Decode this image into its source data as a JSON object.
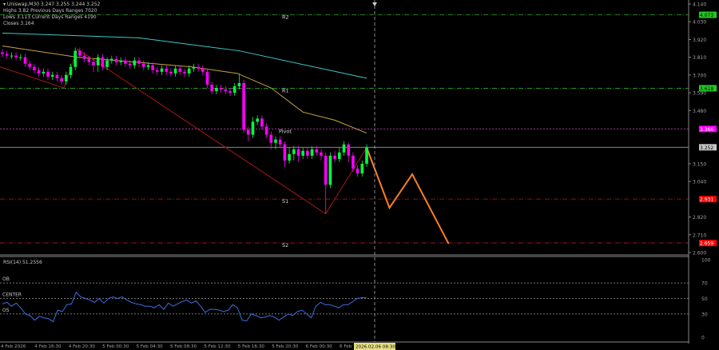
{
  "header": {
    "symbol_line": "Uniswap,M30  3.247 3.255 3.244 3.252",
    "high_line": "Highs 3.82    Previous Days Ranges 7020",
    "low_line": "Lows 3.113    Current Days Ranges 4190",
    "close_line": "Closes 3.164"
  },
  "chart_data": [
    {
      "type": "candlestick",
      "symbol": "Uniswap",
      "timeframe": "M30",
      "ylim": [
        2.6,
        4.14
      ],
      "y_ticks": [
        "4.140",
        "4.030",
        "3.920",
        "3.810",
        "3.700",
        "3.590",
        "3.480",
        "3.150",
        "3.040",
        "2.820",
        "2.710",
        "2.600"
      ],
      "x_ticks": [
        "4 Feb 2026",
        "4 Feb 16:30",
        "4 Feb 20:30",
        "5 Feb 00:30",
        "5 Feb 04:30",
        "5 Feb 08:30",
        "5 Feb 12:30",
        "5 Feb 16:30",
        "5 Feb 20:30",
        "6 Feb 00:30",
        "6 Feb"
      ],
      "crosshair_time": "2026.02.06 08:30",
      "current_price": {
        "label": "3.252",
        "value": 3.252,
        "color": "#9a9a9a"
      },
      "colors": {
        "bull": "#00ff40",
        "bear": "#ff00ff"
      },
      "open": [
        3.84,
        3.83,
        3.82,
        3.82,
        3.81,
        3.81,
        3.77,
        3.75,
        3.73,
        3.71,
        3.72,
        3.69,
        3.7,
        3.68,
        3.66,
        3.7,
        3.75,
        3.85,
        3.82,
        3.8,
        3.78,
        3.76,
        3.81,
        3.75,
        3.79,
        3.8,
        3.78,
        3.79,
        3.77,
        3.76,
        3.79,
        3.77,
        3.75,
        3.76,
        3.73,
        3.72,
        3.74,
        3.72,
        3.71,
        3.74,
        3.72,
        3.71,
        3.74,
        3.75,
        3.74,
        3.72,
        3.64,
        3.6,
        3.62,
        3.61,
        3.6,
        3.59,
        3.63,
        3.65,
        3.36,
        3.33,
        3.41,
        3.43,
        3.38,
        3.33,
        3.28,
        3.3,
        3.27,
        3.17,
        3.21,
        3.24,
        3.2,
        3.23,
        3.2,
        3.24,
        3.22,
        3.2,
        3.02,
        3.2,
        3.18,
        3.22,
        3.27,
        3.2,
        3.12,
        3.09,
        3.15
      ],
      "high": [
        3.86,
        3.85,
        3.84,
        3.84,
        3.83,
        3.83,
        3.79,
        3.77,
        3.75,
        3.74,
        3.74,
        3.72,
        3.72,
        3.7,
        3.72,
        3.77,
        3.87,
        3.87,
        3.84,
        3.82,
        3.8,
        3.83,
        3.83,
        3.81,
        3.82,
        3.82,
        3.81,
        3.81,
        3.79,
        3.81,
        3.81,
        3.79,
        3.78,
        3.78,
        3.75,
        3.76,
        3.76,
        3.74,
        3.76,
        3.76,
        3.74,
        3.76,
        3.77,
        3.77,
        3.76,
        3.74,
        3.66,
        3.64,
        3.64,
        3.63,
        3.62,
        3.65,
        3.71,
        3.67,
        3.38,
        3.44,
        3.45,
        3.45,
        3.4,
        3.35,
        3.32,
        3.32,
        3.29,
        3.25,
        3.26,
        3.26,
        3.25,
        3.25,
        3.26,
        3.26,
        3.24,
        3.22,
        3.22,
        3.23,
        3.25,
        3.29,
        3.28,
        3.22,
        3.14,
        3.17,
        3.27
      ],
      "low": [
        3.81,
        3.8,
        3.8,
        3.79,
        3.79,
        3.75,
        3.73,
        3.71,
        3.69,
        3.69,
        3.67,
        3.67,
        3.66,
        3.64,
        3.64,
        3.68,
        3.73,
        3.8,
        3.78,
        3.76,
        3.72,
        3.72,
        3.73,
        3.73,
        3.77,
        3.76,
        3.76,
        3.75,
        3.74,
        3.74,
        3.75,
        3.73,
        3.73,
        3.71,
        3.7,
        3.7,
        3.7,
        3.69,
        3.69,
        3.7,
        3.69,
        3.69,
        3.72,
        3.72,
        3.7,
        3.62,
        3.58,
        3.58,
        3.59,
        3.58,
        3.57,
        3.57,
        3.61,
        3.34,
        3.29,
        3.31,
        3.39,
        3.36,
        3.31,
        3.24,
        3.24,
        3.25,
        3.13,
        3.15,
        3.17,
        3.16,
        3.18,
        3.18,
        3.18,
        3.2,
        3.17,
        2.84,
        3.0,
        3.16,
        3.16,
        3.2,
        3.16,
        3.1,
        3.07,
        3.07,
        3.13
      ],
      "close": [
        3.83,
        3.82,
        3.82,
        3.81,
        3.81,
        3.77,
        3.75,
        3.73,
        3.71,
        3.72,
        3.69,
        3.7,
        3.68,
        3.66,
        3.7,
        3.75,
        3.85,
        3.82,
        3.8,
        3.78,
        3.76,
        3.81,
        3.75,
        3.79,
        3.8,
        3.78,
        3.79,
        3.77,
        3.76,
        3.79,
        3.77,
        3.75,
        3.76,
        3.73,
        3.72,
        3.74,
        3.72,
        3.71,
        3.74,
        3.72,
        3.71,
        3.74,
        3.75,
        3.74,
        3.72,
        3.64,
        3.6,
        3.62,
        3.61,
        3.6,
        3.59,
        3.63,
        3.65,
        3.36,
        3.33,
        3.41,
        3.43,
        3.38,
        3.33,
        3.28,
        3.3,
        3.27,
        3.17,
        3.21,
        3.24,
        3.2,
        3.23,
        3.2,
        3.24,
        3.22,
        3.2,
        3.02,
        3.2,
        3.18,
        3.22,
        3.27,
        3.2,
        3.12,
        3.09,
        3.15,
        3.25
      ],
      "moving_averages": [
        {
          "color": "#3cc8c8",
          "points": [
            [
              0,
              3.96
            ],
            [
              30,
              3.93
            ],
            [
              52,
              3.85
            ],
            [
              80,
              3.68
            ]
          ]
        },
        {
          "color": "#c8a040",
          "points": [
            [
              0,
              3.88
            ],
            [
              16.5,
              3.81
            ],
            [
              41.6,
              3.75
            ],
            [
              51.6,
              3.71
            ],
            [
              59,
              3.62
            ],
            [
              66,
              3.47
            ],
            [
              73,
              3.42
            ],
            [
              80,
              3.34
            ]
          ]
        }
      ],
      "zigzag": {
        "color": "#a01818",
        "points": [
          [
            -0.5,
            3.75
          ],
          [
            13.5,
            3.62
          ],
          [
            16.5,
            3.86
          ],
          [
            71,
            2.84
          ],
          [
            80,
            3.25
          ]
        ]
      },
      "projection": {
        "color": "#ff8020",
        "points": [
          [
            80,
            3.25
          ],
          [
            85,
            2.877
          ],
          [
            90,
            3.085
          ],
          [
            98,
            2.654
          ]
        ]
      },
      "pivot_levels": [
        {
          "name": "R2",
          "value": 4.073,
          "label": "4.073",
          "color": "#2ea82e",
          "tag": "#22cc22",
          "style": "dashdot"
        },
        {
          "name": "R1",
          "value": 3.618,
          "label": "3.618",
          "color": "#2ea82e",
          "tag": "#22cc22",
          "style": "dashdot"
        },
        {
          "name": "Pivot",
          "value": 3.366,
          "label": "3.366",
          "color": "#c040c0",
          "tag": "#ff00ff",
          "style": "dot"
        },
        {
          "name": "S1",
          "value": 2.931,
          "label": "2.931",
          "color": "#b01818",
          "tag": "#ff0000",
          "style": "dashdot"
        },
        {
          "name": "S2",
          "value": 2.659,
          "label": "2.659",
          "color": "#b01818",
          "tag": "#ff0000",
          "style": "dashdot"
        }
      ]
    },
    {
      "type": "line",
      "title": "RSI(14) 51.2556",
      "ylim": [
        0,
        100
      ],
      "y_ticks": [
        "100",
        "70",
        "50",
        "30",
        "0"
      ],
      "levels": [
        {
          "name": "OB",
          "value": 70
        },
        {
          "name": "CENTER",
          "value": 50
        },
        {
          "name": "OS",
          "value": 30
        }
      ],
      "color": "#3c6ee0",
      "values": [
        43,
        45,
        40,
        44,
        38,
        30,
        28,
        22,
        27,
        25,
        24,
        20,
        35,
        33,
        42,
        43,
        58,
        52,
        50,
        48,
        45,
        50,
        44,
        50,
        52,
        50,
        52,
        48,
        45,
        43,
        42,
        40,
        40,
        38,
        42,
        36,
        44,
        40,
        43,
        46,
        48,
        44,
        47,
        40,
        32,
        36,
        36,
        35,
        33,
        35,
        42,
        38,
        22,
        21,
        30,
        28,
        25,
        26,
        28,
        26,
        22,
        26,
        30,
        28,
        33,
        35,
        30,
        25,
        40,
        45,
        42,
        42,
        40,
        38,
        42,
        42,
        46,
        50,
        51,
        51.26
      ]
    }
  ]
}
